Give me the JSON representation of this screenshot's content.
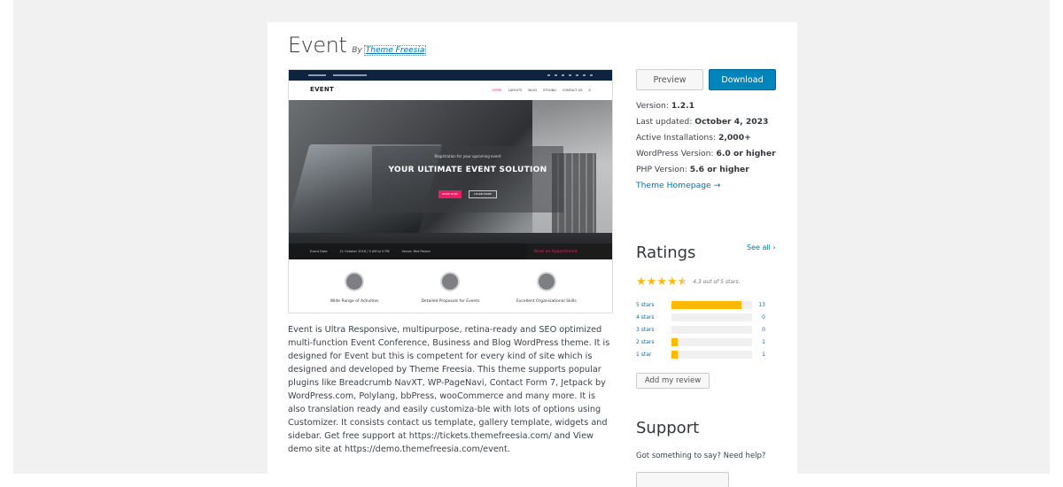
{
  "theme": {
    "name": "Event",
    "by": "By",
    "author": "Theme Freesia"
  },
  "screenshot": {
    "logo": "EVENT",
    "nav": [
      "HOME",
      "LAYOUTS",
      "BLOG",
      "STYLING",
      "CONTACT US"
    ],
    "hero_subtitle": "Registration for your upcoming event",
    "hero_title": "YOUR ULTIMATE EVENT SOLUTION",
    "hero_btn_primary": "BOOK NOW",
    "hero_btn_secondary": "LEARN MORE",
    "bar_items": [
      "Event Date",
      "21 October 2016 / 9 AM to 5 PM",
      "Venue: Red Palace"
    ],
    "appointment": "Book an Appointment",
    "features": [
      "Wide Range of Activities",
      "Detailed Proposals for Events",
      "Excellent Organisational Skills"
    ]
  },
  "description": "Event is Ultra Responsive, multipurpose, retina-ready and SEO optimized multi-function Event Conference, Business and Blog WordPress theme. It is designed for Event but this is competent for every kind of site which is designed and developed by Theme Freesia. This theme supports popular plugins like Breadcrumb NavXT, WP-PageNavi, Contact Form 7, Jetpack by WordPress.com, Polylang, bbPress, wooCommerce and many more. It is also translation ready and easily customiza-ble with lots of options using Customizer. It consists contact us template, gallery template, widgets and sidebar. Get free support at https://tickets.themefreesia.com/ and View demo site at https://demo.themefreesia.com/event.",
  "actions": {
    "preview": "Preview",
    "download": "Download"
  },
  "meta": {
    "version_label": "Version:",
    "version": "1.2.1",
    "updated_label": "Last updated:",
    "updated": "October 4, 2023",
    "installs_label": "Active Installations:",
    "installs": "2,000+",
    "wp_label": "WordPress Version:",
    "wp": "6.0 or higher",
    "php_label": "PHP Version:",
    "php": "5.6 or higher",
    "homepage": "Theme Homepage →"
  },
  "ratings": {
    "heading": "Ratings",
    "see_all": "See all ›",
    "average_text": "4.3 out of 5 stars.",
    "average": 4.3,
    "rows": [
      {
        "label": "5 stars",
        "count": "13",
        "fraction": 0.87
      },
      {
        "label": "4 stars",
        "count": "0",
        "fraction": 0
      },
      {
        "label": "3 stars",
        "count": "0",
        "fraction": 0
      },
      {
        "label": "2 stars",
        "count": "1",
        "fraction": 0.07
      },
      {
        "label": "1 star",
        "count": "1",
        "fraction": 0.07
      }
    ],
    "add_review": "Add my review"
  },
  "support": {
    "heading": "Support",
    "text": "Got something to say? Need help?"
  },
  "colors": {
    "accent": "#0085ba",
    "star": "#ffb900",
    "link": "#0073aa"
  }
}
